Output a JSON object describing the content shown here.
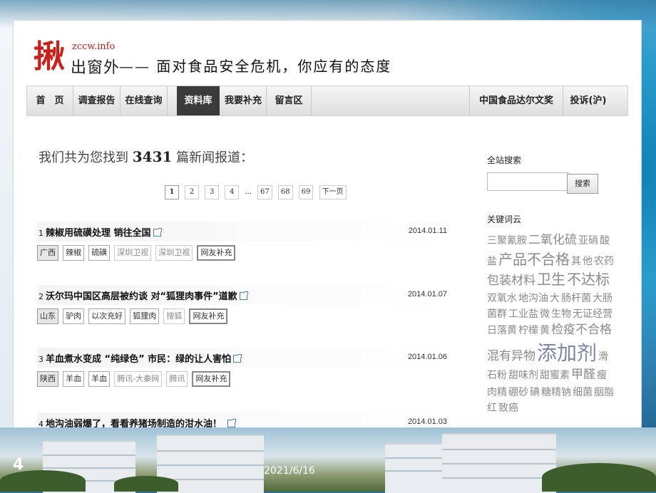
{
  "site": {
    "logo_mark": "揪",
    "logo_url": "zccw.info",
    "logo_name": "出窗外",
    "slogan": "—— 面对食品安全危机，你应有的态度"
  },
  "nav": {
    "items": [
      {
        "label": "首　页"
      },
      {
        "label": "调查报告"
      },
      {
        "label": "在线查询"
      },
      {
        "label": "资料库",
        "active": true
      },
      {
        "label": "我要补充"
      },
      {
        "label": "留言区"
      },
      {
        "label": "中国食品达尔文奖"
      },
      {
        "label": "投诉(沪)"
      }
    ]
  },
  "results": {
    "prefix": "我们共为您找到",
    "count": "3431",
    "suffix": "篇新闻报道："
  },
  "pager": {
    "pages": [
      "1",
      "2",
      "3",
      "4"
    ],
    "ellipsis": "...",
    "last_pages": [
      "67",
      "68",
      "69"
    ],
    "next": "下一页",
    "current": "1"
  },
  "articles": [
    {
      "num": "1",
      "title": "辣椒用硫磺处理 销往全国",
      "date": "2014.01.11",
      "tags": [
        "广西",
        "辣椒",
        "硫磺",
        "深圳卫视",
        "深圳卫视",
        "网友补充"
      ]
    },
    {
      "num": "2",
      "title": "沃尔玛中国区高层被约谈 对“狐狸肉事件”道歉",
      "date": "2014.01.07",
      "tags": [
        "山东",
        "驴肉",
        "以次充好",
        "狐狸肉",
        "搜狐",
        "网友补充"
      ]
    },
    {
      "num": "3",
      "title": "羊血煮水变成 “纯绿色” 市民：绿的让人害怕",
      "date": "2014.01.06",
      "tags": [
        "陕西",
        "羊血",
        "羊血",
        "腾讯-大秦网",
        "腾讯",
        "网友补充"
      ]
    },
    {
      "num": "4",
      "title": "地沟油弱爆了，看看养猪场制造的泔水油！",
      "date": "2014.01.03",
      "tags": []
    }
  ],
  "sidebar": {
    "search_label": "全站搜索",
    "search_button": "搜索",
    "search_value": "",
    "keywords_label": "关键词云",
    "cloud": [
      {
        "text": "三聚氰胺",
        "size": "s"
      },
      {
        "text": "二氧化硫",
        "size": "m"
      },
      {
        "text": "亚硝",
        "size": "s"
      },
      {
        "text": "酸盐",
        "size": "s"
      },
      {
        "text": "产品不合格",
        "size": "l"
      },
      {
        "text": "其",
        "size": "s"
      },
      {
        "text": "他",
        "size": "s"
      },
      {
        "text": "农药",
        "size": "s"
      },
      {
        "text": "包装材料",
        "size": "m"
      },
      {
        "text": "卫生",
        "size": "l"
      },
      {
        "text": "不达标",
        "size": "l"
      },
      {
        "text": "双氧水",
        "size": "s"
      },
      {
        "text": "地沟油",
        "size": "s"
      },
      {
        "text": "大",
        "size": "s"
      },
      {
        "text": "肠杆菌",
        "size": "s"
      },
      {
        "text": "大肠菌群",
        "size": "s"
      },
      {
        "text": "工业盐",
        "size": "s"
      },
      {
        "text": "微",
        "size": "s"
      },
      {
        "text": "生物",
        "size": "s"
      },
      {
        "text": "无证经营",
        "size": "s"
      },
      {
        "text": "日落黄",
        "size": "s"
      },
      {
        "text": "柠檬",
        "size": "s"
      },
      {
        "text": "黄",
        "size": "s"
      },
      {
        "text": "检疫不合格",
        "size": "m"
      },
      {
        "text": "混有异物",
        "size": "m"
      },
      {
        "text": "添加剂",
        "size": "xl"
      },
      {
        "text": "滑石粉",
        "size": "s"
      },
      {
        "text": "甜味剂",
        "size": "s"
      },
      {
        "text": "甜蜜素",
        "size": "s"
      },
      {
        "text": "甲醛",
        "size": "m"
      },
      {
        "text": "瘦肉精",
        "size": "s"
      },
      {
        "text": "硼砂",
        "size": "s"
      },
      {
        "text": "碘",
        "size": "s"
      },
      {
        "text": "糖精钠",
        "size": "s"
      },
      {
        "text": "细菌",
        "size": "s"
      },
      {
        "text": "胭脂红",
        "size": "s"
      },
      {
        "text": "致癌",
        "size": "s"
      }
    ]
  },
  "slide": {
    "number": "4",
    "date": "2021/6/16"
  },
  "colors": {
    "brand_red": "#c8201a",
    "nav_active_bg": "#3b3b3b",
    "cloud_text": "#8a8a8a"
  }
}
